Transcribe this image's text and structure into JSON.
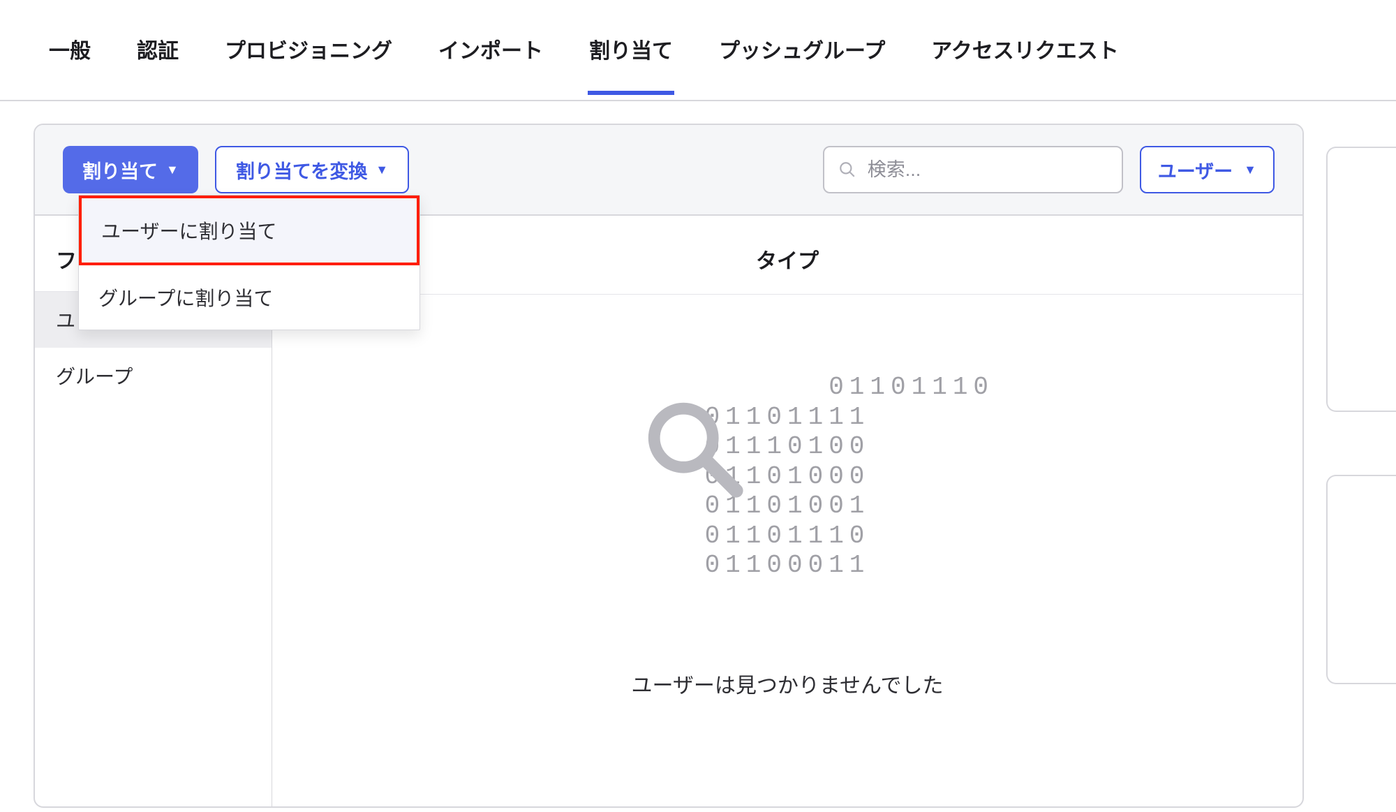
{
  "tabs": [
    {
      "label": "一般"
    },
    {
      "label": "認証"
    },
    {
      "label": "プロビジョニング"
    },
    {
      "label": "インポート"
    },
    {
      "label": "割り当て",
      "active": true
    },
    {
      "label": "プッシュグループ"
    },
    {
      "label": "アクセスリクエスト"
    }
  ],
  "toolbar": {
    "assign_label": "割り当て",
    "convert_label": "割り当てを変換",
    "search_placeholder": "検索...",
    "filter_label": "ユーザー"
  },
  "dropdown": {
    "items": [
      {
        "label": "ユーザーに割り当て",
        "highlight": true
      },
      {
        "label": "グループに割り当て"
      }
    ]
  },
  "sidebar": {
    "header": "フ",
    "items": [
      {
        "label": "ユ",
        "active": true
      },
      {
        "label": "グループ"
      }
    ]
  },
  "main": {
    "column_header": "タイプ",
    "binary_lines": [
      "01101110",
      "01101111",
      "01110100",
      "01101000",
      "01101001",
      "01101110",
      "01100011"
    ],
    "empty_message": "ユーザーは見つかりませんでした"
  }
}
